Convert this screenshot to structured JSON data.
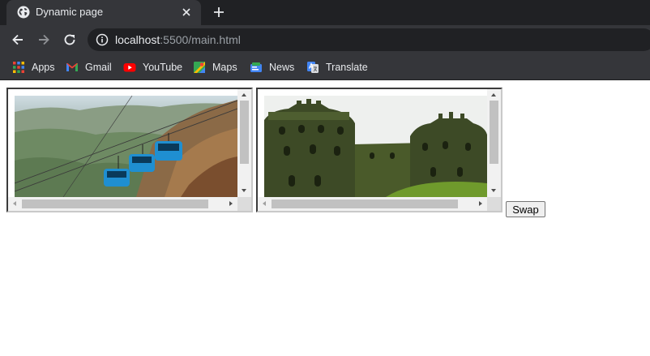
{
  "tab": {
    "title": "Dynamic page",
    "favicon": "globe-icon"
  },
  "toolbar": {
    "url_host": "localhost",
    "url_rest": ":5500/main.html"
  },
  "bookmarks": [
    {
      "label": "Apps",
      "icon": "apps-grid-icon"
    },
    {
      "label": "Gmail",
      "icon": "gmail-icon"
    },
    {
      "label": "YouTube",
      "icon": "youtube-icon"
    },
    {
      "label": "Maps",
      "icon": "maps-icon"
    },
    {
      "label": "News",
      "icon": "news-icon"
    },
    {
      "label": "Translate",
      "icon": "translate-icon"
    }
  ],
  "frames": [
    {
      "name": "ropeway-frame",
      "content": "ropeway-cable-cars-image"
    },
    {
      "name": "fort-frame",
      "content": "fort-ruins-image"
    }
  ],
  "swap_label": "Swap",
  "colors": {
    "tabstrip": "#202124",
    "toolbar": "#35363a",
    "omnibox": "#202124",
    "text_light": "#e8eaed",
    "text_dim": "#9aa0a6"
  }
}
